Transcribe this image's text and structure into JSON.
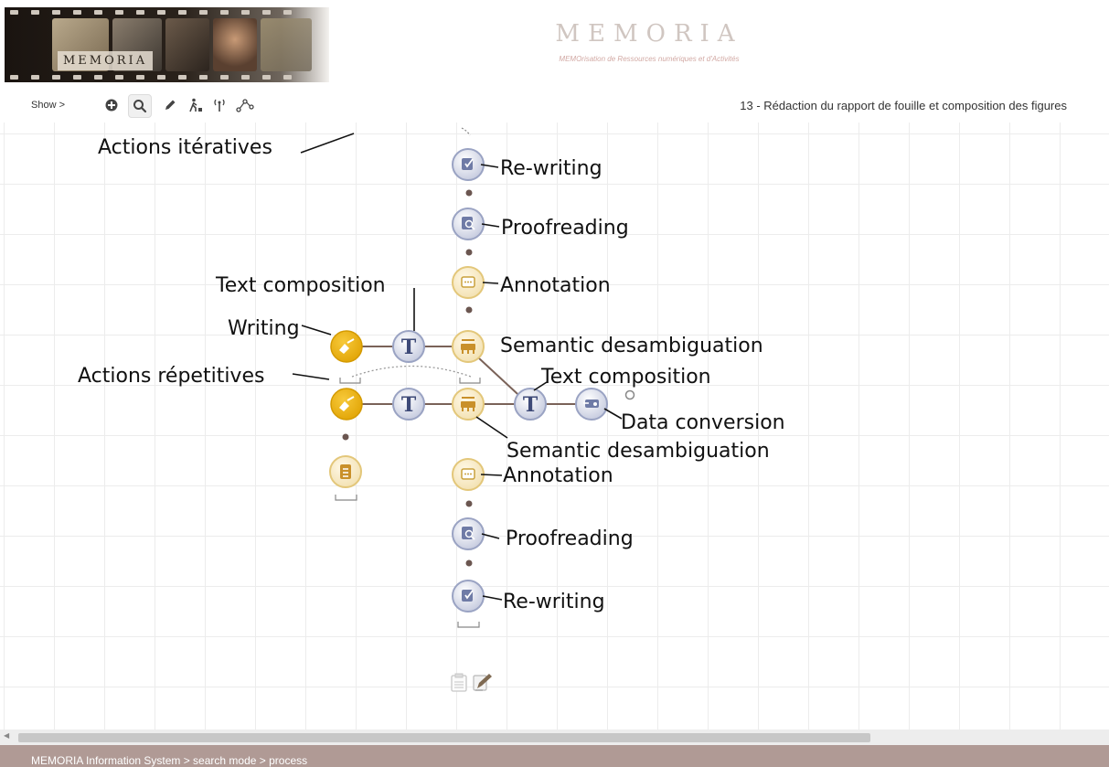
{
  "header": {
    "banner_logo": "MEMORIA",
    "app_title": "MEMORIA",
    "app_subtitle": "MEMOrisation de Ressources numériques et d'Activités"
  },
  "toolbar": {
    "show_label": "Show >",
    "tools": [
      "add-icon",
      "search-icon",
      "pencil-icon",
      "walker-icon",
      "antenna-icon",
      "graph-icon"
    ],
    "process_title": "13 - Rédaction du rapport de fouille et composition des figures"
  },
  "diagram": {
    "annotations": {
      "iterative": "Actions itératives",
      "repetitive": "Actions répetitives"
    },
    "upper_column": [
      "Re-writing",
      "Proofreading",
      "Annotation"
    ],
    "upper_row": {
      "writing": "Writing",
      "text_composition": "Text composition",
      "semantic": "Semantic desambiguation"
    },
    "merge": {
      "text_composition": "Text composition",
      "data_conversion": "Data conversion"
    },
    "lower_row": {
      "semantic": "Semantic desambiguation"
    },
    "lower_column": [
      "Annotation",
      "Proofreading",
      "Re-writing"
    ],
    "node_letter": "T",
    "colors": {
      "gold": "#e8b10e",
      "gold_border": "#e3c77a",
      "blue_border": "#9aa3c3",
      "line": "#7a6258"
    }
  },
  "statusbar": {
    "breadcrumb": "MEMORIA  Information System  >  search mode > process"
  }
}
